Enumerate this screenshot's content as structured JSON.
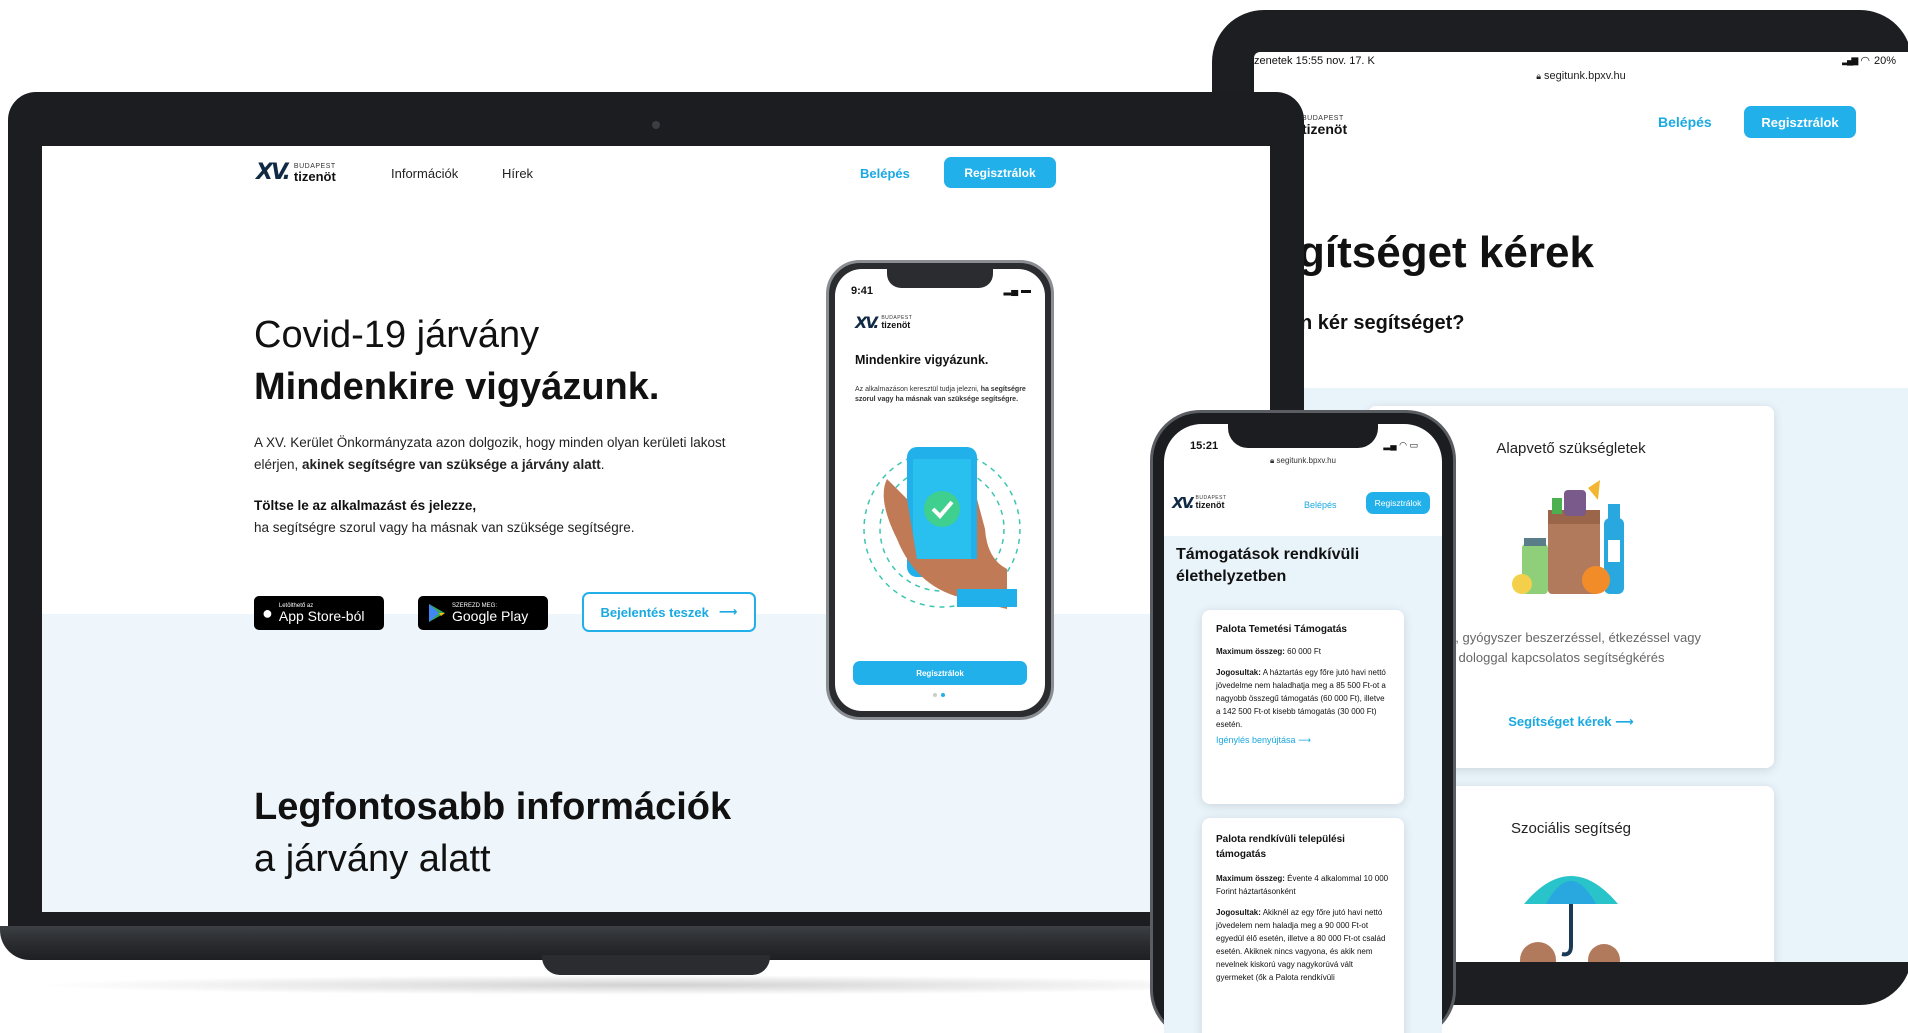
{
  "brand": {
    "logo_mark": "XV.",
    "logo_top": "BUDAPEST",
    "logo_bottom": "tizenöt"
  },
  "laptop": {
    "nav": {
      "items": [
        "Információk",
        "Hírek"
      ],
      "login": "Belépés",
      "register": "Regisztrálok"
    },
    "hero": {
      "title_line1": "Covid-19 járvány",
      "title_line2": "Mindenkire vigyázunk.",
      "para1_plain": "A XV. Kerület Önkormányzata azon dolgozik, hogy minden olyan kerületi lakost elérjen, ",
      "para1_bold": "akinek segítségre van szüksége a járvány alatt",
      "para1_end": ".",
      "para2_bold": "Töltse le az alkalmazást és jelezze,",
      "para2_plain": "ha segítségre szorul vagy ha másnak van szüksége segítségre.",
      "appstore_small": "Letölthető az",
      "appstore_big": "App Store-ból",
      "gplay_small": "SZEREZD MEG:",
      "gplay_big": "Google Play",
      "report_button": "Bejelentés teszek",
      "arrow": "⟶"
    },
    "section": {
      "title_bold": "Legfontosabb információk",
      "title_light": "a járvány alatt"
    }
  },
  "phone_small": {
    "time": "9:41",
    "heading": "Mindenkire vigyázunk.",
    "text_plain": "Az alkalmazáson keresztül tudja jelezni,",
    "text_bold": "ha segítségre szorul vagy ha másnak van szüksége segítségre.",
    "button": "Regisztrálok"
  },
  "tablet": {
    "status_left": "zenetek   15:55   nov. 17. K",
    "status_right": "20%",
    "url": "segitunk.bpxv.hu",
    "login": "Belépés",
    "register": "Regisztrálok",
    "heading": "gítséget kérek",
    "subheading": "n kér segítséget?",
    "card1": {
      "title": "Alapvető szükségletek",
      "desc": "evásárlással, gyógyszer beszerzéssel, étkezéssel vagy egyéb dologgal kapcsolatos segítségkérés",
      "link": "Segítséget kérek",
      "arrow": "⟶"
    },
    "card2": {
      "title": "Szociális segítség"
    }
  },
  "phone_large": {
    "time": "15:21",
    "url": "segitunk.bpxv.hu",
    "login": "Belépés",
    "register": "Regisztrálok",
    "heading": "Támogatások rendkívüli élethelyzetben",
    "card1": {
      "title": "Palota Temetési Támogatás",
      "max_label": "Maximum összeg:",
      "max_value": "60 000 Ft",
      "elig_label": "Jogosultak:",
      "elig_value": "A háztartás egy főre jutó havi nettó jövedelme nem haladhatja meg a 85 500 Ft-ot a nagyobb összegű támogatás (60 000 Ft), illetve a 142 500 Ft-ot kisebb támogatás (30 000 Ft) esetén.",
      "link": "Igénylés benyújtása",
      "arrow": "⟶"
    },
    "card2": {
      "title": "Palota rendkívüli települési támogatás",
      "max_label": "Maximum összeg:",
      "max_value": "Évente 4 alkalommal 10 000 Forint háztartásonként",
      "elig_label": "Jogosultak:",
      "elig_value": "Akiknél az egy főre jutó havi nettó jövedelem nem haladja meg a 90 000 Ft-ot egyedül élő esetén, illetve a 80 000 Ft-ot család esetén. Akiknek nincs vagyona, és akik nem nevelnek kiskorú vagy nagykorúvá vált gyermeket (ők a Palota rendkívüli"
    }
  },
  "colors": {
    "accent": "#1aa9e1",
    "button": "#22b0ea",
    "navy": "#102a44",
    "band": "#eef6fb"
  }
}
